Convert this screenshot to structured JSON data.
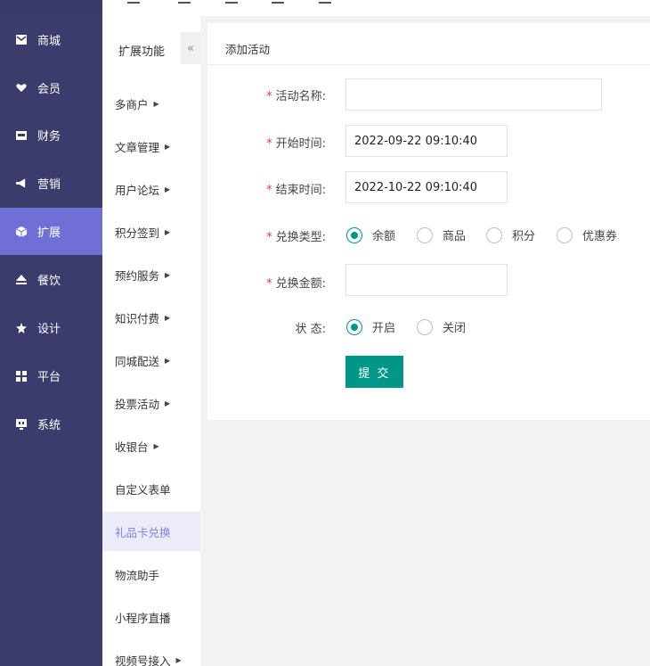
{
  "sidebar": {
    "items": [
      {
        "label": "商城",
        "icon": "mail-icon"
      },
      {
        "label": "会员",
        "icon": "heart-icon"
      },
      {
        "label": "财务",
        "icon": "wallet-icon"
      },
      {
        "label": "营销",
        "icon": "megaphone-icon"
      },
      {
        "label": "扩展",
        "icon": "cube-icon"
      },
      {
        "label": "餐饮",
        "icon": "eject-icon"
      },
      {
        "label": "设计",
        "icon": "puzzle-icon"
      },
      {
        "label": "平台",
        "icon": "grid-icon"
      },
      {
        "label": "系统",
        "icon": "monitor-icon"
      }
    ],
    "active_color": "#6f6fd6",
    "bg_color": "#3b3b6c"
  },
  "submenu": {
    "title": "扩展功能",
    "collapse_icon": "«",
    "items": [
      {
        "label": "多商户",
        "has_arrow": true
      },
      {
        "label": "文章管理",
        "has_arrow": true
      },
      {
        "label": "用户论坛",
        "has_arrow": true
      },
      {
        "label": "积分签到",
        "has_arrow": true
      },
      {
        "label": "预约服务",
        "has_arrow": true
      },
      {
        "label": "知识付费",
        "has_arrow": true
      },
      {
        "label": "同城配送",
        "has_arrow": true
      },
      {
        "label": "投票活动",
        "has_arrow": true
      },
      {
        "label": "收银台",
        "has_arrow": true
      },
      {
        "label": "自定义表单",
        "has_arrow": false
      },
      {
        "label": "礼品卡兑换",
        "has_arrow": false
      },
      {
        "label": "物流助手",
        "has_arrow": false
      },
      {
        "label": "小程序直播",
        "has_arrow": false
      },
      {
        "label": "视频号接入",
        "has_arrow": true
      }
    ]
  },
  "form": {
    "title": "添加活动",
    "fields": {
      "name": {
        "label": "活动名称:",
        "value": ""
      },
      "start": {
        "label": "开始时间:",
        "value": "2022-09-22 09:10:40"
      },
      "end": {
        "label": "结束时间:",
        "value": "2022-10-22 09:10:40"
      },
      "type": {
        "label": "兑换类型:",
        "options": [
          "余额",
          "商品",
          "积分",
          "优惠券"
        ],
        "selected": "余额"
      },
      "amount": {
        "label": "兑换金额:",
        "value": ""
      },
      "status": {
        "label": "状 态:",
        "options": [
          "开启",
          "关闭"
        ],
        "selected": "开启"
      }
    },
    "submit_label": "提 交"
  },
  "accent_color": "#009688",
  "required_mark": "*"
}
